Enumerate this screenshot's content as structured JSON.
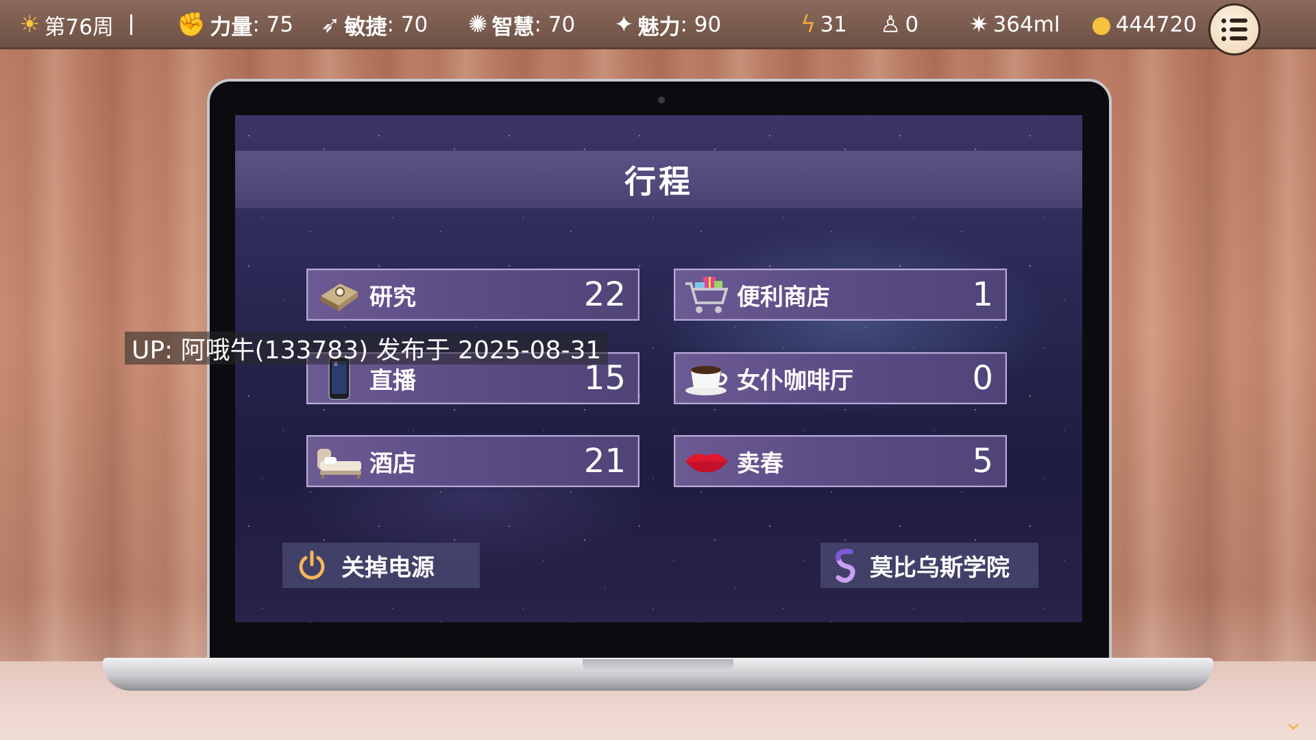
{
  "status_bar": {
    "week": "第76周",
    "strength": {
      "label": "力量",
      "value": ": 75"
    },
    "agility": {
      "label": "敏捷",
      "value": ": 70"
    },
    "wisdom": {
      "label": "智慧",
      "value": ": 70"
    },
    "charm": {
      "label": "魅力",
      "value": ": 90"
    },
    "energy": "31",
    "followers": "0",
    "fluid": "364ml",
    "coins": "444720"
  },
  "screen": {
    "title": "行程",
    "items": [
      {
        "name": "研究",
        "count": "22",
        "icon": "book-icon"
      },
      {
        "name": "便利商店",
        "count": "1",
        "icon": "shopping-cart-icon"
      },
      {
        "name": "直播",
        "count": "15",
        "icon": "phone-icon"
      },
      {
        "name": "女仆咖啡厅",
        "count": "0",
        "icon": "coffee-cup-icon"
      },
      {
        "name": "酒店",
        "count": "21",
        "icon": "bed-icon"
      },
      {
        "name": "卖春",
        "count": "5",
        "icon": "lips-icon"
      }
    ],
    "power_button": "关掉电源",
    "academy_button": "莫比乌斯学院"
  },
  "caption": "UP: 阿哦牛(133783) 发布于 2025-08-31",
  "colors": {
    "accent_gold": "#f6c33d",
    "panel_purple": "#5d4d86",
    "item_border": "#b8a9d8"
  }
}
